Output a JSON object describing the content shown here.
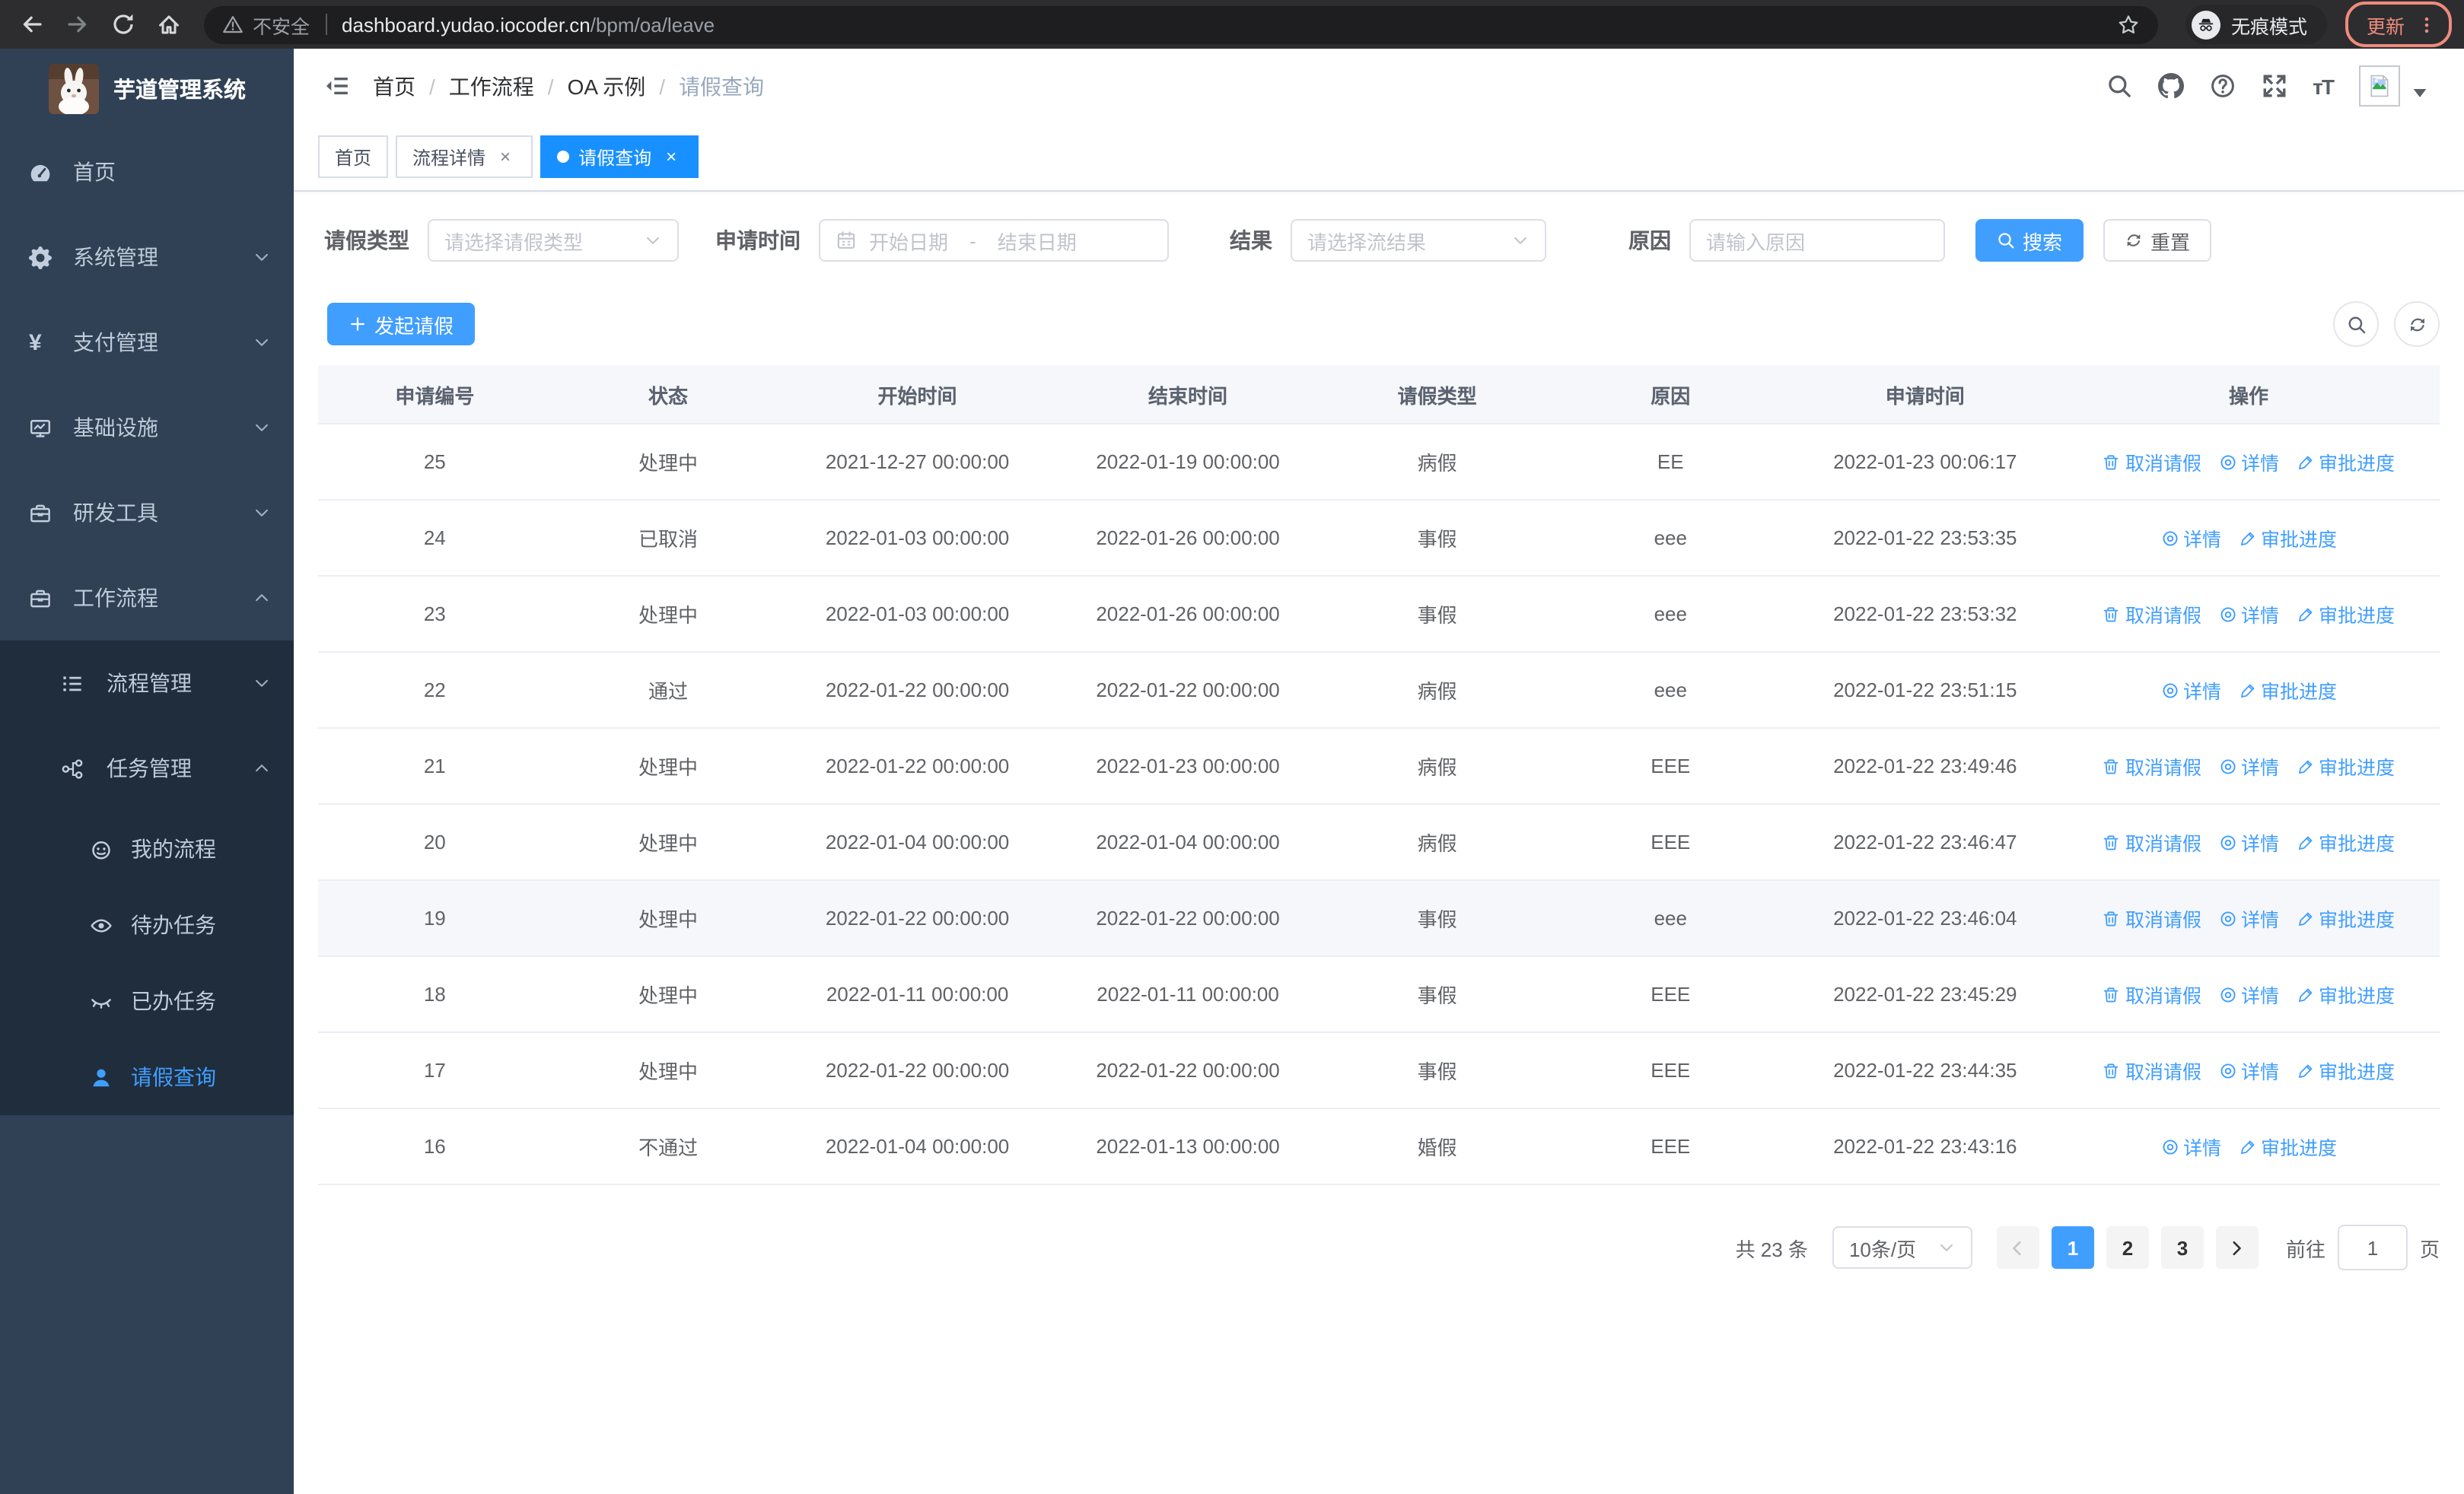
{
  "browser": {
    "security_label": "不安全",
    "url_host": "dashboard.yudao.iocoder.cn",
    "url_path": "/bpm/oa/leave",
    "incognito_label": "无痕模式",
    "update_label": "更新"
  },
  "sidebar": {
    "logo_title": "芋道管理系统",
    "menu": [
      {
        "label": "首页",
        "icon": "dashboard-icon",
        "level": 1
      },
      {
        "label": "系统管理",
        "icon": "gear-icon",
        "level": 1,
        "arrow": "down"
      },
      {
        "label": "支付管理",
        "icon": "yen-icon",
        "level": 1,
        "arrow": "down"
      },
      {
        "label": "基础设施",
        "icon": "monitor-icon",
        "level": 1,
        "arrow": "down"
      },
      {
        "label": "研发工具",
        "icon": "toolbox-icon",
        "level": 1,
        "arrow": "down"
      },
      {
        "label": "工作流程",
        "icon": "briefcase-icon",
        "level": 1,
        "arrow": "up"
      },
      {
        "label": "流程管理",
        "icon": "list-tree-icon",
        "level": 2,
        "arrow": "down"
      },
      {
        "label": "任务管理",
        "icon": "flow-icon",
        "level": 2,
        "arrow": "up"
      },
      {
        "label": "我的流程",
        "icon": "robot-icon",
        "level": 3
      },
      {
        "label": "待办任务",
        "icon": "eye-open-icon",
        "level": 3
      },
      {
        "label": "已办任务",
        "icon": "eye-closed-icon",
        "level": 3
      },
      {
        "label": "请假查询",
        "icon": "user-icon",
        "level": 3,
        "active": true
      }
    ]
  },
  "header": {
    "breadcrumbs": [
      "首页",
      "工作流程",
      "OA 示例",
      "请假查询"
    ],
    "icons": [
      "search",
      "github",
      "help",
      "fullscreen",
      "font-size",
      "avatar"
    ]
  },
  "tabs": [
    {
      "label": "首页",
      "closable": false,
      "active": false
    },
    {
      "label": "流程详情",
      "closable": true,
      "active": false
    },
    {
      "label": "请假查询",
      "closable": true,
      "active": true
    }
  ],
  "filters": {
    "leave_type_label": "请假类型",
    "leave_type_placeholder": "请选择请假类型",
    "apply_time_label": "申请时间",
    "start_date_placeholder": "开始日期",
    "date_separator": "-",
    "end_date_placeholder": "结束日期",
    "result_label": "结果",
    "result_placeholder": "请选择流结果",
    "reason_label": "原因",
    "reason_placeholder": "请输入原因",
    "search_label": "搜索",
    "reset_label": "重置"
  },
  "toolbar": {
    "create_label": "发起请假"
  },
  "table": {
    "columns": [
      "申请编号",
      "状态",
      "开始时间",
      "结束时间",
      "请假类型",
      "原因",
      "申请时间",
      "操作"
    ],
    "action_labels": {
      "cancel": "取消请假",
      "detail": "详情",
      "progress": "审批进度"
    },
    "rows": [
      {
        "id": "25",
        "status": "处理中",
        "start": "2021-12-27 00:00:00",
        "end": "2022-01-19 00:00:00",
        "type": "病假",
        "reason": "EE",
        "applied": "2022-01-23 00:06:17",
        "actions": [
          "cancel",
          "detail",
          "progress"
        ]
      },
      {
        "id": "24",
        "status": "已取消",
        "start": "2022-01-03 00:00:00",
        "end": "2022-01-26 00:00:00",
        "type": "事假",
        "reason": "eee",
        "applied": "2022-01-22 23:53:35",
        "actions": [
          "detail",
          "progress"
        ]
      },
      {
        "id": "23",
        "status": "处理中",
        "start": "2022-01-03 00:00:00",
        "end": "2022-01-26 00:00:00",
        "type": "事假",
        "reason": "eee",
        "applied": "2022-01-22 23:53:32",
        "actions": [
          "cancel",
          "detail",
          "progress"
        ]
      },
      {
        "id": "22",
        "status": "通过",
        "start": "2022-01-22 00:00:00",
        "end": "2022-01-22 00:00:00",
        "type": "病假",
        "reason": "eee",
        "applied": "2022-01-22 23:51:15",
        "actions": [
          "detail",
          "progress"
        ]
      },
      {
        "id": "21",
        "status": "处理中",
        "start": "2022-01-22 00:00:00",
        "end": "2022-01-23 00:00:00",
        "type": "病假",
        "reason": "EEE",
        "applied": "2022-01-22 23:49:46",
        "actions": [
          "cancel",
          "detail",
          "progress"
        ]
      },
      {
        "id": "20",
        "status": "处理中",
        "start": "2022-01-04 00:00:00",
        "end": "2022-01-04 00:00:00",
        "type": "病假",
        "reason": "EEE",
        "applied": "2022-01-22 23:46:47",
        "actions": [
          "cancel",
          "detail",
          "progress"
        ]
      },
      {
        "id": "19",
        "status": "处理中",
        "start": "2022-01-22 00:00:00",
        "end": "2022-01-22 00:00:00",
        "type": "事假",
        "reason": "eee",
        "applied": "2022-01-22 23:46:04",
        "actions": [
          "cancel",
          "detail",
          "progress"
        ],
        "highlight": true
      },
      {
        "id": "18",
        "status": "处理中",
        "start": "2022-01-11 00:00:00",
        "end": "2022-01-11 00:00:00",
        "type": "事假",
        "reason": "EEE",
        "applied": "2022-01-22 23:45:29",
        "actions": [
          "cancel",
          "detail",
          "progress"
        ]
      },
      {
        "id": "17",
        "status": "处理中",
        "start": "2022-01-22 00:00:00",
        "end": "2022-01-22 00:00:00",
        "type": "事假",
        "reason": "EEE",
        "applied": "2022-01-22 23:44:35",
        "actions": [
          "cancel",
          "detail",
          "progress"
        ]
      },
      {
        "id": "16",
        "status": "不通过",
        "start": "2022-01-04 00:00:00",
        "end": "2022-01-13 00:00:00",
        "type": "婚假",
        "reason": "EEE",
        "applied": "2022-01-22 23:43:16",
        "actions": [
          "detail",
          "progress"
        ]
      }
    ]
  },
  "pagination": {
    "total_label": "共 23 条",
    "page_size": "10条/页",
    "pages": [
      "1",
      "2",
      "3"
    ],
    "current_page": "1",
    "goto_label": "前往",
    "goto_value": "1",
    "page_unit": "页"
  },
  "colors": {
    "primary": "#409eff",
    "tab_active": "#1890ff",
    "sidebar_bg": "#304156",
    "submenu_bg": "#1f2d3d",
    "update_button": "#ef8b7c"
  }
}
